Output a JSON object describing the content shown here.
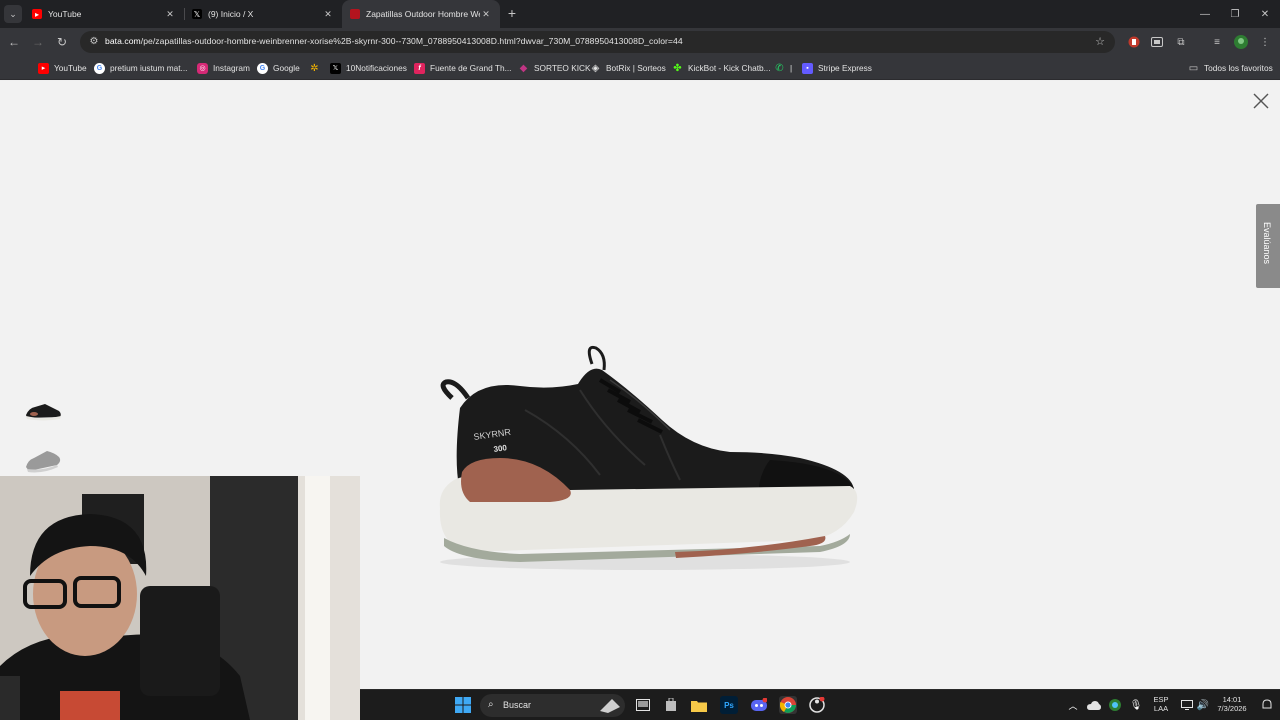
{
  "browser": {
    "tabs": [
      {
        "title": "YouTube",
        "favicon": "youtube-icon",
        "active": false
      },
      {
        "title": "(9) Inicio / X",
        "favicon": "x-icon",
        "active": false
      },
      {
        "title": "Zapatillas Outdoor Hombre We",
        "favicon": "bata-icon",
        "active": true
      }
    ],
    "tab_close_glyph": "✕",
    "new_tab_glyph": "+",
    "url_host": "bata.com",
    "url_path": "/pe/zapatillas-outdoor-hombre-weinbrenner-xorise%2B-skyrnr-300--730M_0788950413008D.html?dwvar_730M_0788950413008D_color=44",
    "bookmarks": [
      {
        "label": "YouTube",
        "icon": "youtube-icon",
        "color": "#ff0000"
      },
      {
        "label": "pretium iustum mat...",
        "icon": "google-icon",
        "color": "#4285f4"
      },
      {
        "label": "Instagram",
        "icon": "instagram-icon",
        "color": "#d62976"
      },
      {
        "label": "Google",
        "icon": "google-icon",
        "color": "#4285f4"
      },
      {
        "label": "",
        "icon": "pinwheel-icon",
        "color": "#f4b400"
      },
      {
        "label": "10Notificaciones",
        "icon": "x-icon",
        "color": "#000000"
      },
      {
        "label": "Fuente de Grand Th...",
        "icon": "font-f-icon",
        "color": "#e0245e"
      },
      {
        "label": "SORTEO KICK",
        "icon": "kick-icon",
        "color": "#c13584"
      },
      {
        "label": "BotRix | Sorteos",
        "icon": "botrix-icon",
        "color": "#9e9e9e"
      },
      {
        "label": "KickBot - Kick Chatb...",
        "icon": "kickbot-icon",
        "color": "#53fc18"
      },
      {
        "label": "|",
        "icon": "whatsapp-icon",
        "color": "#25d366"
      },
      {
        "label": "Stripe Express",
        "icon": "stripe-icon",
        "color": "#635bff"
      }
    ],
    "all_favorites_label": "Todos los favoritos"
  },
  "page": {
    "side_tab_label": "Evalúanos",
    "product": {
      "brand_text": "SKYRNR",
      "model_text": "300"
    }
  },
  "taskbar": {
    "search_placeholder": "Buscar",
    "language_top": "ESP",
    "language_bottom": "LAA",
    "time": "14:01",
    "date": "7/3/2026"
  },
  "colors": {
    "tabstrip": "#202124",
    "toolbar": "#35363a",
    "page_bg": "#f2f2f2",
    "shoe_upper": "#1b1b1b",
    "shoe_accent": "#a0624f",
    "shoe_midsole": "#e9e8e3",
    "side_tab": "#8a8a8a"
  }
}
